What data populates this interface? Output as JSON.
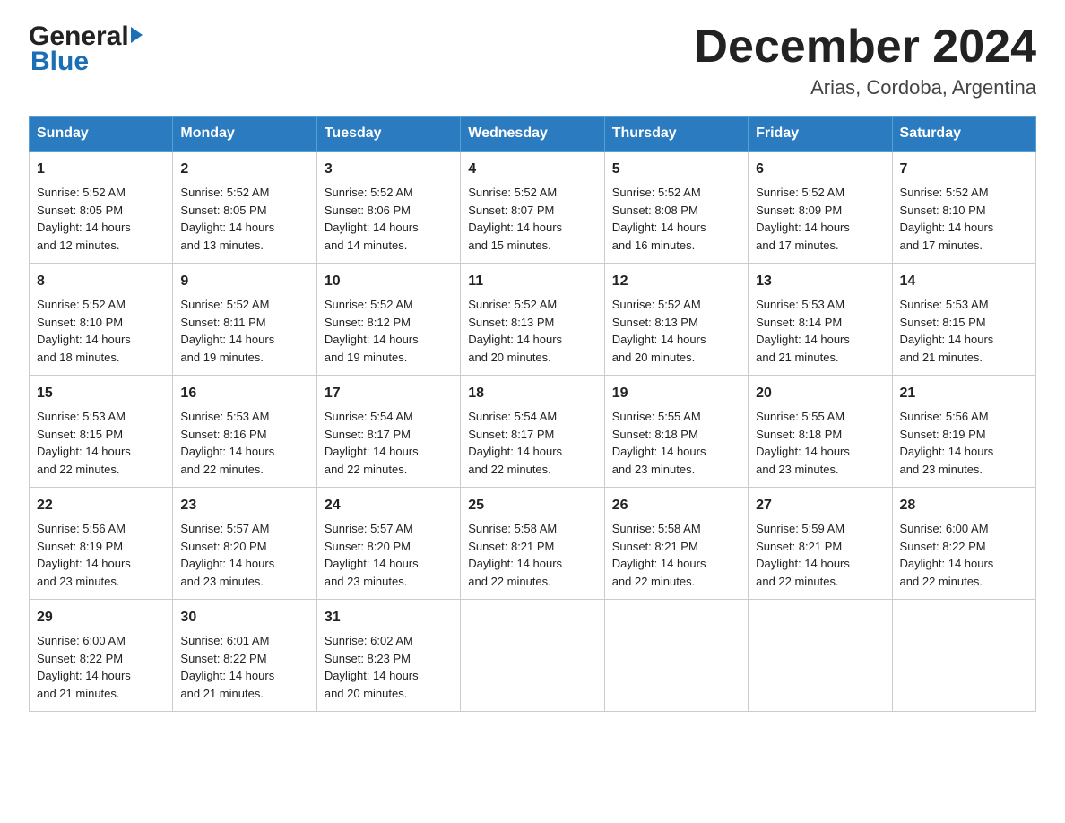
{
  "header": {
    "month_title": "December 2024",
    "location": "Arias, Cordoba, Argentina",
    "logo_general": "General",
    "logo_blue": "Blue"
  },
  "days_of_week": [
    "Sunday",
    "Monday",
    "Tuesday",
    "Wednesday",
    "Thursday",
    "Friday",
    "Saturday"
  ],
  "weeks": [
    [
      {
        "day": "1",
        "sunrise": "5:52 AM",
        "sunset": "8:05 PM",
        "daylight": "14 hours and 12 minutes."
      },
      {
        "day": "2",
        "sunrise": "5:52 AM",
        "sunset": "8:05 PM",
        "daylight": "14 hours and 13 minutes."
      },
      {
        "day": "3",
        "sunrise": "5:52 AM",
        "sunset": "8:06 PM",
        "daylight": "14 hours and 14 minutes."
      },
      {
        "day": "4",
        "sunrise": "5:52 AM",
        "sunset": "8:07 PM",
        "daylight": "14 hours and 15 minutes."
      },
      {
        "day": "5",
        "sunrise": "5:52 AM",
        "sunset": "8:08 PM",
        "daylight": "14 hours and 16 minutes."
      },
      {
        "day": "6",
        "sunrise": "5:52 AM",
        "sunset": "8:09 PM",
        "daylight": "14 hours and 17 minutes."
      },
      {
        "day": "7",
        "sunrise": "5:52 AM",
        "sunset": "8:10 PM",
        "daylight": "14 hours and 17 minutes."
      }
    ],
    [
      {
        "day": "8",
        "sunrise": "5:52 AM",
        "sunset": "8:10 PM",
        "daylight": "14 hours and 18 minutes."
      },
      {
        "day": "9",
        "sunrise": "5:52 AM",
        "sunset": "8:11 PM",
        "daylight": "14 hours and 19 minutes."
      },
      {
        "day": "10",
        "sunrise": "5:52 AM",
        "sunset": "8:12 PM",
        "daylight": "14 hours and 19 minutes."
      },
      {
        "day": "11",
        "sunrise": "5:52 AM",
        "sunset": "8:13 PM",
        "daylight": "14 hours and 20 minutes."
      },
      {
        "day": "12",
        "sunrise": "5:52 AM",
        "sunset": "8:13 PM",
        "daylight": "14 hours and 20 minutes."
      },
      {
        "day": "13",
        "sunrise": "5:53 AM",
        "sunset": "8:14 PM",
        "daylight": "14 hours and 21 minutes."
      },
      {
        "day": "14",
        "sunrise": "5:53 AM",
        "sunset": "8:15 PM",
        "daylight": "14 hours and 21 minutes."
      }
    ],
    [
      {
        "day": "15",
        "sunrise": "5:53 AM",
        "sunset": "8:15 PM",
        "daylight": "14 hours and 22 minutes."
      },
      {
        "day": "16",
        "sunrise": "5:53 AM",
        "sunset": "8:16 PM",
        "daylight": "14 hours and 22 minutes."
      },
      {
        "day": "17",
        "sunrise": "5:54 AM",
        "sunset": "8:17 PM",
        "daylight": "14 hours and 22 minutes."
      },
      {
        "day": "18",
        "sunrise": "5:54 AM",
        "sunset": "8:17 PM",
        "daylight": "14 hours and 22 minutes."
      },
      {
        "day": "19",
        "sunrise": "5:55 AM",
        "sunset": "8:18 PM",
        "daylight": "14 hours and 23 minutes."
      },
      {
        "day": "20",
        "sunrise": "5:55 AM",
        "sunset": "8:18 PM",
        "daylight": "14 hours and 23 minutes."
      },
      {
        "day": "21",
        "sunrise": "5:56 AM",
        "sunset": "8:19 PM",
        "daylight": "14 hours and 23 minutes."
      }
    ],
    [
      {
        "day": "22",
        "sunrise": "5:56 AM",
        "sunset": "8:19 PM",
        "daylight": "14 hours and 23 minutes."
      },
      {
        "day": "23",
        "sunrise": "5:57 AM",
        "sunset": "8:20 PM",
        "daylight": "14 hours and 23 minutes."
      },
      {
        "day": "24",
        "sunrise": "5:57 AM",
        "sunset": "8:20 PM",
        "daylight": "14 hours and 23 minutes."
      },
      {
        "day": "25",
        "sunrise": "5:58 AM",
        "sunset": "8:21 PM",
        "daylight": "14 hours and 22 minutes."
      },
      {
        "day": "26",
        "sunrise": "5:58 AM",
        "sunset": "8:21 PM",
        "daylight": "14 hours and 22 minutes."
      },
      {
        "day": "27",
        "sunrise": "5:59 AM",
        "sunset": "8:21 PM",
        "daylight": "14 hours and 22 minutes."
      },
      {
        "day": "28",
        "sunrise": "6:00 AM",
        "sunset": "8:22 PM",
        "daylight": "14 hours and 22 minutes."
      }
    ],
    [
      {
        "day": "29",
        "sunrise": "6:00 AM",
        "sunset": "8:22 PM",
        "daylight": "14 hours and 21 minutes."
      },
      {
        "day": "30",
        "sunrise": "6:01 AM",
        "sunset": "8:22 PM",
        "daylight": "14 hours and 21 minutes."
      },
      {
        "day": "31",
        "sunrise": "6:02 AM",
        "sunset": "8:23 PM",
        "daylight": "14 hours and 20 minutes."
      },
      null,
      null,
      null,
      null
    ]
  ],
  "labels": {
    "sunrise": "Sunrise:",
    "sunset": "Sunset:",
    "daylight": "Daylight:"
  },
  "colors": {
    "header_bg": "#2a7bbf",
    "header_text": "#ffffff",
    "border": "#cccccc"
  }
}
